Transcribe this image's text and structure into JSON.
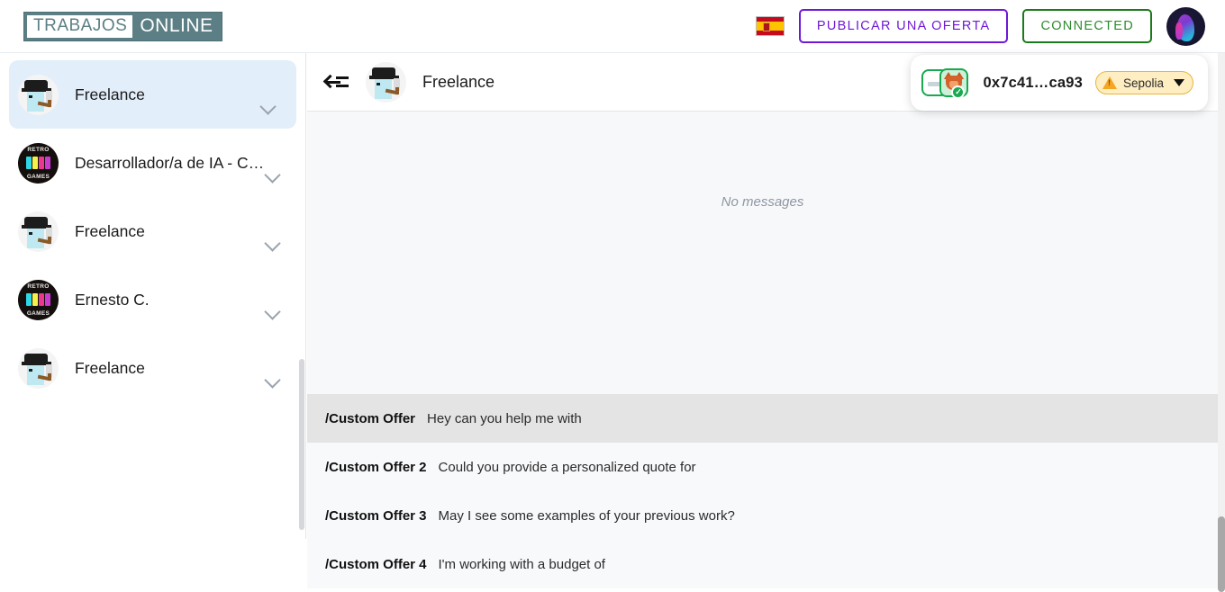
{
  "topbar": {
    "logo_part1": "TRABAJOS",
    "logo_part2": "ONLINE",
    "language_flag": "spain-flag-icon",
    "publish_label": "PUBLICAR UNA OFERTA",
    "connected_label": "CONNECTED",
    "avatar_name": "user-avatar",
    "accent_purple": "#6e19d6",
    "accent_green": "#2e8b2e",
    "logo_teal": "#5c7f85"
  },
  "wallet": {
    "address": "0x7c41…ca93",
    "network": "Sepolia",
    "network_badge_color": "#ffeec2",
    "network_border_color": "#e8b53c",
    "connected_check": "✓",
    "wallet_icon": "metamask-fox-icon"
  },
  "sidebar": {
    "items": [
      {
        "name": "Freelance",
        "avatar": "cryptopunk-avatar",
        "active": true
      },
      {
        "name": "Desarrollador/a de IA - Chat ...",
        "avatar": "retro-games-avatar",
        "active": false
      },
      {
        "name": "Freelance",
        "avatar": "cryptopunk-avatar",
        "active": false
      },
      {
        "name": "Ernesto C.",
        "avatar": "retro-games-avatar",
        "active": false
      },
      {
        "name": "Freelance",
        "avatar": "cryptopunk-avatar",
        "active": false
      }
    ]
  },
  "chat": {
    "header_title": "Freelance",
    "header_avatar": "cryptopunk-avatar",
    "back_icon": "collapse-back-icon",
    "empty_state": "No messages"
  },
  "suggestions": [
    {
      "command": "/Custom Offer",
      "text": "Hey can you help me with",
      "selected": true
    },
    {
      "command": "/Custom Offer 2",
      "text": "Could you provide a personalized quote for",
      "selected": false
    },
    {
      "command": "/Custom Offer 3",
      "text": "May I see some examples of your previous work?",
      "selected": false
    },
    {
      "command": "/Custom Offer 4",
      "text": "I'm working with a budget of",
      "selected": false
    }
  ],
  "retro_logo": {
    "top_text": "RETRO",
    "bottom_text": "GAMES"
  }
}
